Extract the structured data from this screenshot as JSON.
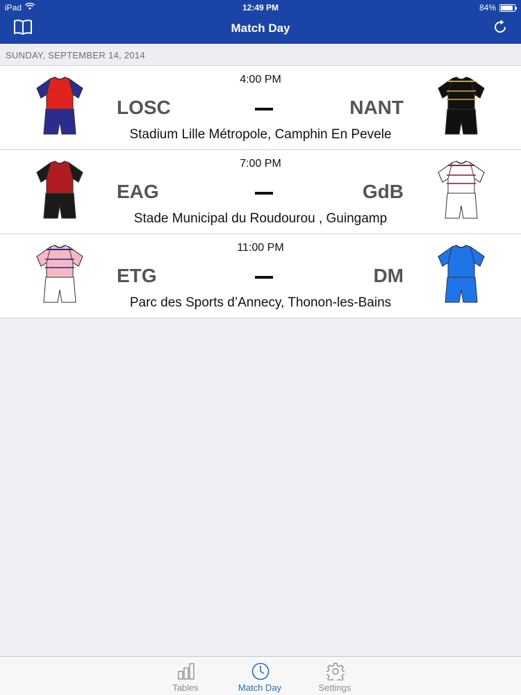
{
  "status_bar": {
    "device": "iPad",
    "time": "12:49 PM",
    "battery": "84%"
  },
  "nav": {
    "title": "Match Day",
    "left_icon": "book-icon",
    "right_icon": "refresh-icon"
  },
  "section": {
    "date": "SUNDAY, SEPTEMBER 14, 2014"
  },
  "matches": [
    {
      "time": "4:00 PM",
      "home": "LOSC",
      "away": "NANT",
      "venue": "Stadium Lille Métropole, Camphin En Pevele",
      "home_kit": {
        "shirt": "#e0231f",
        "sleeve": "#2a2d8c",
        "shorts": "#2a2d8c"
      },
      "away_kit": {
        "shirt": "#111111",
        "sleeve": "#111111",
        "shorts": "#111111",
        "stripe": "#c9a83a"
      }
    },
    {
      "time": "7:00 PM",
      "home": "EAG",
      "away": "GdB",
      "venue": "Stade Municipal du Roudourou , Guingamp",
      "home_kit": {
        "shirt": "#b01c22",
        "sleeve": "#1a1a1a",
        "shorts": "#1a1a1a"
      },
      "away_kit": {
        "shirt": "#ffffff",
        "sleeve": "#ffffff",
        "shorts": "#ffffff",
        "stripe": "#8a2250"
      }
    },
    {
      "time": "11:00 PM",
      "home": "ETG",
      "away": "DM",
      "venue": "Parc des Sports d’Annecy, Thonon-les-Bains",
      "home_kit": {
        "shirt": "#f6b9c3",
        "sleeve": "#f6b9c3",
        "shorts": "#ffffff",
        "stripe": "#2a2d8c"
      },
      "away_kit": {
        "shirt": "#1f74e8",
        "sleeve": "#1f74e8",
        "shorts": "#1f74e8"
      }
    }
  ],
  "tabs": [
    {
      "label": "Tables",
      "icon": "bar-chart-icon",
      "active": false
    },
    {
      "label": "Match Day",
      "icon": "clock-icon",
      "active": true
    },
    {
      "label": "Settings",
      "icon": "gear-icon",
      "active": false
    }
  ],
  "colors": {
    "nav_bar": "#1a44a8",
    "accent": "#1f6fce",
    "background": "#efeff4"
  }
}
